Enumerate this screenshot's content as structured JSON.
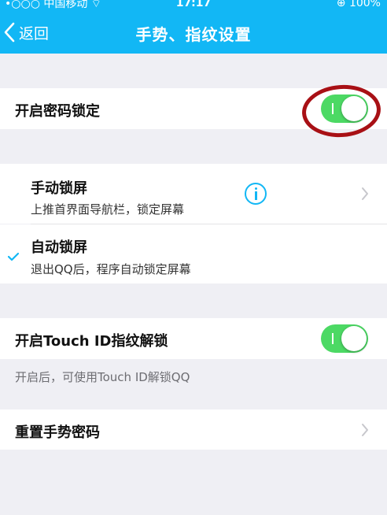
{
  "status_bar": {
    "carrier": "•○○○ 中国移动 ⌔",
    "time": "17:17",
    "battery": "⊕ 100%"
  },
  "nav": {
    "back_label": "返回",
    "title": "手势、指纹设置"
  },
  "password_lock": {
    "label": "开启密码锁定",
    "enabled": true
  },
  "manual_lock": {
    "title": "手动锁屏",
    "subtitle": "上推首界面导航栏，锁定屏幕"
  },
  "auto_lock": {
    "title": "自动锁屏",
    "subtitle": "退出QQ后，程序自动锁定屏幕",
    "selected": true
  },
  "touch_id": {
    "label": "开启Touch ID指纹解锁",
    "enabled": true,
    "footnote": "开启后，可使用Touch ID解锁QQ"
  },
  "reset_gesture": {
    "label": "重置手势密码"
  },
  "colors": {
    "accent": "#12b7f5",
    "switch_on": "#4cd964",
    "annotation": "#a81015",
    "background": "#efeff4"
  },
  "icons": [
    "back-chevron-icon",
    "info-icon",
    "checkmark-icon",
    "chevron-right-icon"
  ]
}
